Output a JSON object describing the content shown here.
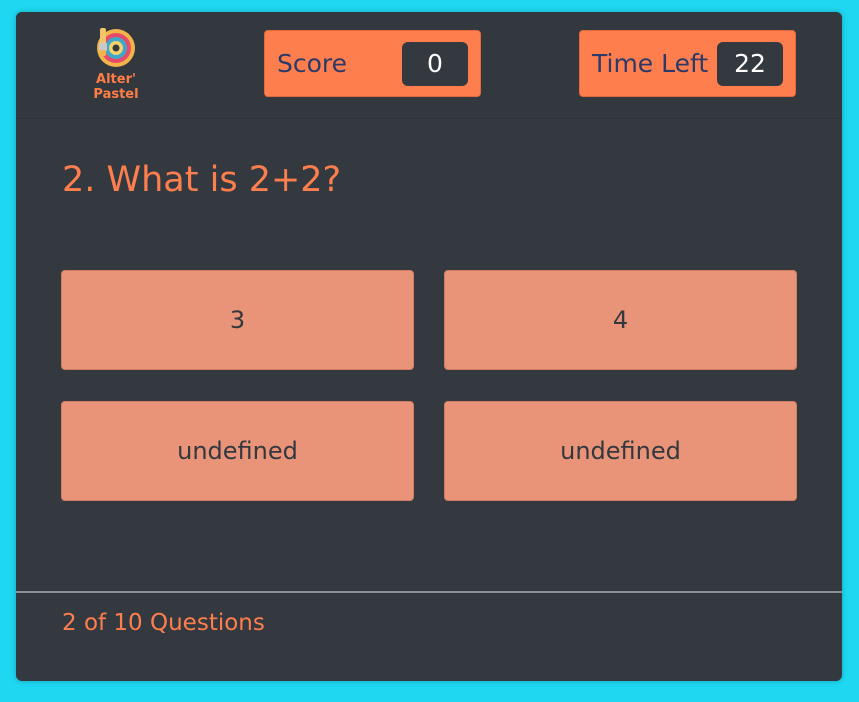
{
  "brand": {
    "logo_line1": "Alter'",
    "logo_line2": "Pastel"
  },
  "hud": {
    "score_label": "Score",
    "score_value": "0",
    "time_label": "Time Left",
    "time_value": "22"
  },
  "question": {
    "text": "2. What is 2+2?"
  },
  "answers": [
    {
      "label": "3"
    },
    {
      "label": "4"
    },
    {
      "label": "undefined"
    },
    {
      "label": "undefined"
    }
  ],
  "footer": {
    "progress": "2 of 10 Questions"
  },
  "colors": {
    "background": "#1ed8f2",
    "card": "#343940",
    "accent": "#ff7e4d",
    "answer_bg": "#e99478",
    "label_text": "#2b3a68"
  }
}
